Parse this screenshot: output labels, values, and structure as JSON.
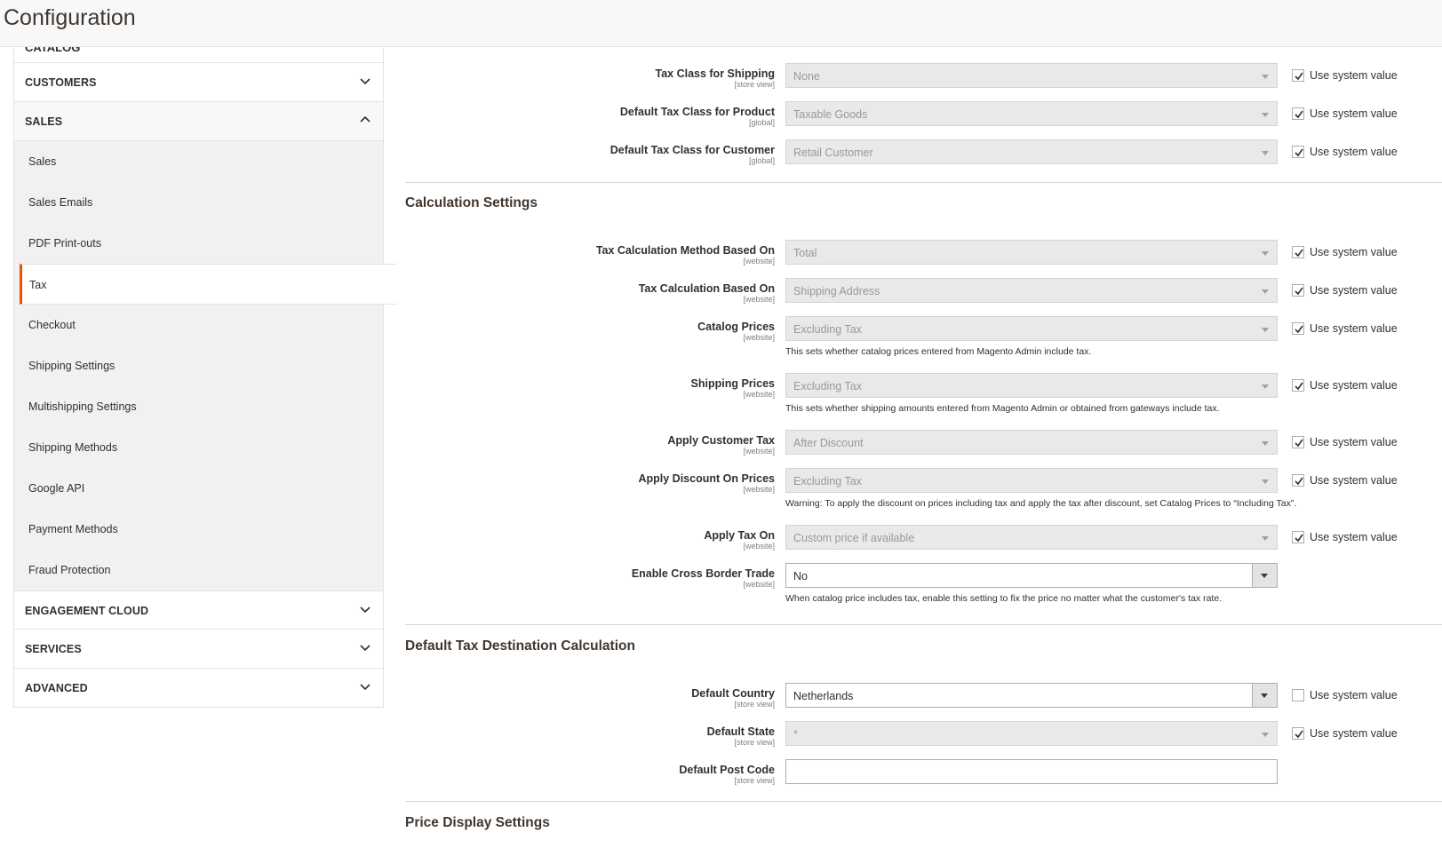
{
  "header": {
    "title": "Configuration"
  },
  "sidebar": {
    "cut_label": "CATALOG",
    "customers": "CUSTOMERS",
    "sales": "SALES",
    "sales_items": [
      "Sales",
      "Sales Emails",
      "PDF Print-outs",
      "Tax",
      "Checkout",
      "Shipping Settings",
      "Multishipping Settings",
      "Shipping Methods",
      "Google API",
      "Payment Methods",
      "Fraud Protection"
    ],
    "engagement": "ENGAGEMENT CLOUD",
    "services": "SERVICES",
    "advanced": "ADVANCED"
  },
  "use_system_value": "Use system value",
  "tax_classes": {
    "shipping": {
      "label": "Tax Class for Shipping",
      "scope": "[store view]",
      "value": "None"
    },
    "product": {
      "label": "Default Tax Class for Product",
      "scope": "[global]",
      "value": "Taxable Goods"
    },
    "customer": {
      "label": "Default Tax Class for Customer",
      "scope": "[global]",
      "value": "Retail Customer"
    }
  },
  "calc": {
    "title": "Calculation Settings",
    "method": {
      "label": "Tax Calculation Method Based On",
      "scope": "[website]",
      "value": "Total"
    },
    "based_on": {
      "label": "Tax Calculation Based On",
      "scope": "[website]",
      "value": "Shipping Address"
    },
    "catalog_prices": {
      "label": "Catalog Prices",
      "scope": "[website]",
      "value": "Excluding Tax",
      "note": "This sets whether catalog prices entered from Magento Admin include tax."
    },
    "shipping_prices": {
      "label": "Shipping Prices",
      "scope": "[website]",
      "value": "Excluding Tax",
      "note": "This sets whether shipping amounts entered from Magento Admin or obtained from gateways include tax."
    },
    "customer_tax": {
      "label": "Apply Customer Tax",
      "scope": "[website]",
      "value": "After Discount"
    },
    "discount": {
      "label": "Apply Discount On Prices",
      "scope": "[website]",
      "value": "Excluding Tax",
      "note": "Warning: To apply the discount on prices including tax and apply the tax after discount, set Catalog Prices to “Including Tax”."
    },
    "tax_on": {
      "label": "Apply Tax On",
      "scope": "[website]",
      "value": "Custom price if available"
    },
    "cross_border": {
      "label": "Enable Cross Border Trade",
      "scope": "[website]",
      "value": "No",
      "note": "When catalog price includes tax, enable this setting to fix the price no matter what the customer's tax rate."
    }
  },
  "dest": {
    "title": "Default Tax Destination Calculation",
    "country": {
      "label": "Default Country",
      "scope": "[store view]",
      "value": "Netherlands"
    },
    "state": {
      "label": "Default State",
      "scope": "[store view]",
      "value": "*"
    },
    "postcode": {
      "label": "Default Post Code",
      "scope": "[store view]",
      "value": ""
    }
  },
  "price_display": {
    "title": "Price Display Settings"
  }
}
